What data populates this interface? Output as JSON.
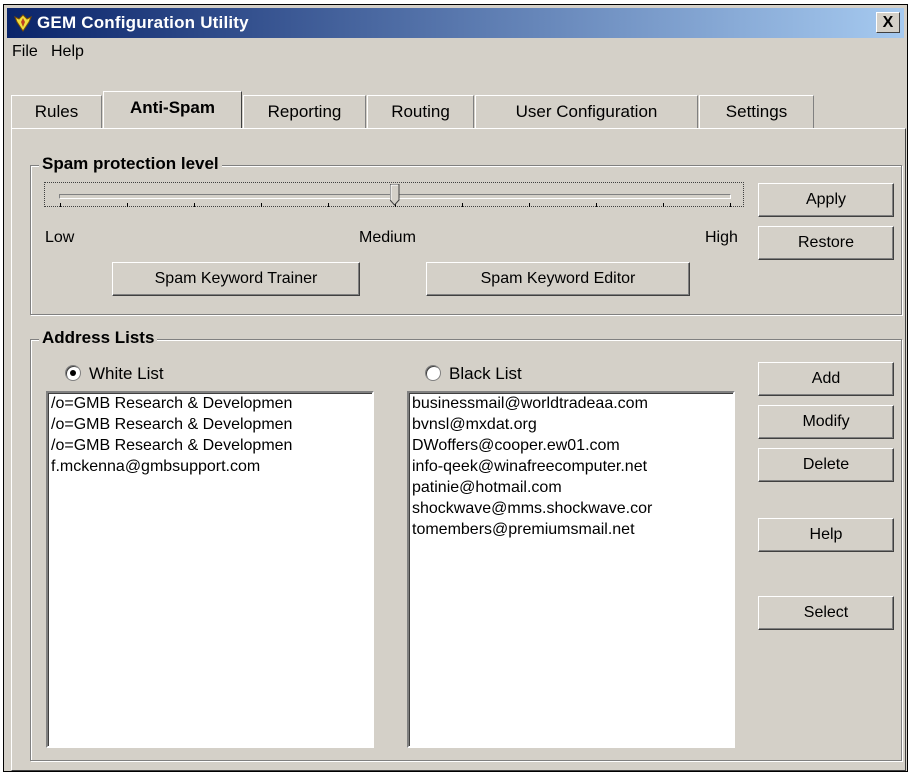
{
  "window": {
    "title": "GEM Configuration Utility",
    "close_label": "X"
  },
  "menu": [
    "File",
    "Help"
  ],
  "tabs": [
    "Rules",
    "Anti-Spam",
    "Reporting",
    "Routing",
    "User Configuration",
    "Settings"
  ],
  "active_tab": "Anti-Spam",
  "spam_protection": {
    "title": "Spam protection level",
    "level_labels": {
      "low": "Low",
      "medium": "Medium",
      "high": "High"
    },
    "level": 0.5,
    "apply_label": "Apply",
    "restore_label": "Restore",
    "trainer_label": "Spam Keyword Trainer",
    "editor_label": "Spam Keyword Editor"
  },
  "address_lists": {
    "title": "Address Lists",
    "selected_list": "White List",
    "white_list": {
      "label": "White List",
      "items": [
        "/o=GMB Research & Developmen",
        "/o=GMB Research & Developmen",
        "/o=GMB Research & Developmen",
        "f.mckenna@gmbsupport.com"
      ]
    },
    "black_list": {
      "label": "Black List",
      "items": [
        "businessmail@worldtradeaa.com",
        "bvnsl@mxdat.org",
        "DWoffers@cooper.ew01.com",
        "info-qeek@winafreecomputer.net",
        "patinie@hotmail.com",
        "shockwave@mms.shockwave.cor",
        "tomembers@premiumsmail.net"
      ]
    },
    "buttons": {
      "add": "Add",
      "modify": "Modify",
      "delete": "Delete",
      "help": "Help",
      "select": "Select"
    }
  },
  "colors": {
    "titlebar_start": "#0a246a",
    "titlebar_end": "#a6caf0",
    "face": "#d4d0c8"
  }
}
